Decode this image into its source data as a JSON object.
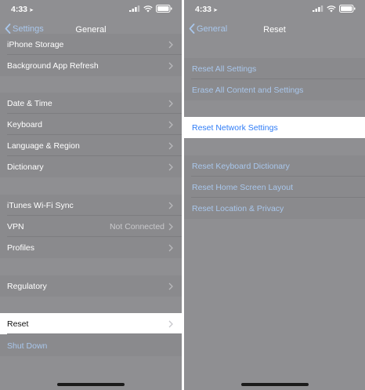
{
  "left": {
    "status": {
      "time": "4:33",
      "location_icon": "location-arrow-icon"
    },
    "nav": {
      "back_label": "Settings",
      "title": "General"
    },
    "rows": [
      {
        "label": "iPhone Storage"
      },
      {
        "label": "Background App Refresh"
      },
      {
        "label": "Date & Time"
      },
      {
        "label": "Keyboard"
      },
      {
        "label": "Language & Region"
      },
      {
        "label": "Dictionary"
      },
      {
        "label": "iTunes Wi-Fi Sync"
      },
      {
        "label": "VPN",
        "detail": "Not Connected"
      },
      {
        "label": "Profiles"
      },
      {
        "label": "Regulatory"
      },
      {
        "label": "Reset"
      },
      {
        "label": "Shut Down"
      }
    ]
  },
  "right": {
    "status": {
      "time": "4:33"
    },
    "nav": {
      "back_label": "General",
      "title": "Reset"
    },
    "rows": [
      {
        "label": "Reset All Settings"
      },
      {
        "label": "Erase All Content and Settings"
      },
      {
        "label": "Reset Network Settings"
      },
      {
        "label": "Reset Keyboard Dictionary"
      },
      {
        "label": "Reset Home Screen Layout"
      },
      {
        "label": "Reset Location & Privacy"
      }
    ]
  },
  "colors": {
    "dimmed_background": "#8f8f92",
    "highlight_row": "#ffffff",
    "link_blue": "#2f7cf6",
    "dimmed_link": "#a9c7ec"
  }
}
